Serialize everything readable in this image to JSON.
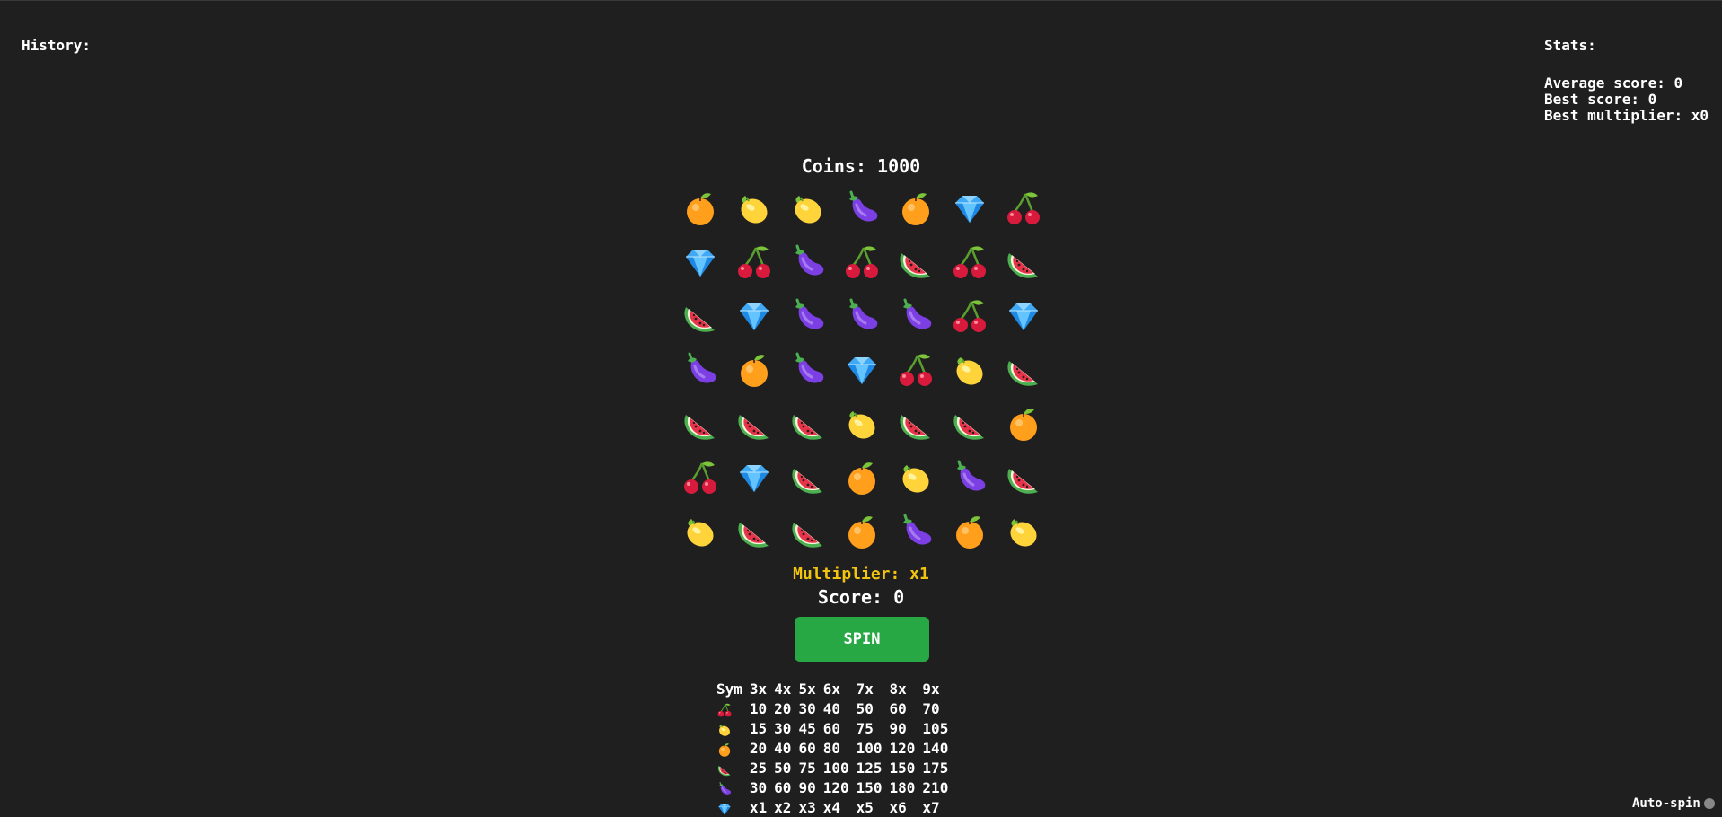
{
  "history": {
    "label": "History:"
  },
  "stats": {
    "title": "Stats:",
    "average_score": "Average score: 0",
    "best_score": "Best score: 0",
    "best_multiplier": "Best multiplier: x0"
  },
  "coins": "Coins: 1000",
  "grid": [
    [
      "orange",
      "lemon",
      "lemon",
      "eggplant",
      "orange",
      "diamond",
      "cherry"
    ],
    [
      "diamond",
      "cherry",
      "eggplant",
      "cherry",
      "watermelon",
      "cherry",
      "watermelon"
    ],
    [
      "watermelon",
      "diamond",
      "eggplant",
      "eggplant",
      "eggplant",
      "cherry",
      "diamond"
    ],
    [
      "eggplant",
      "orange",
      "eggplant",
      "diamond",
      "cherry",
      "lemon",
      "watermelon"
    ],
    [
      "watermelon",
      "watermelon",
      "watermelon",
      "lemon",
      "watermelon",
      "watermelon",
      "orange"
    ],
    [
      "cherry",
      "diamond",
      "watermelon",
      "orange",
      "lemon",
      "eggplant",
      "watermelon"
    ],
    [
      "lemon",
      "watermelon",
      "watermelon",
      "orange",
      "eggplant",
      "orange",
      "lemon"
    ]
  ],
  "multiplier": "Multiplier: x1",
  "score": "Score: 0",
  "spin_label": "SPIN",
  "paytable": {
    "headers": [
      "Sym",
      "3x",
      "4x",
      "5x",
      "6x",
      "7x",
      "8x",
      "9x"
    ],
    "rows": [
      {
        "symbol": "cherry",
        "values": [
          "10",
          "20",
          "30",
          "40",
          "50",
          "60",
          "70"
        ]
      },
      {
        "symbol": "lemon",
        "values": [
          "15",
          "30",
          "45",
          "60",
          "75",
          "90",
          "105"
        ]
      },
      {
        "symbol": "orange",
        "values": [
          "20",
          "40",
          "60",
          "80",
          "100",
          "120",
          "140"
        ]
      },
      {
        "symbol": "watermelon",
        "values": [
          "25",
          "50",
          "75",
          "100",
          "125",
          "150",
          "175"
        ]
      },
      {
        "symbol": "eggplant",
        "values": [
          "30",
          "60",
          "90",
          "120",
          "150",
          "180",
          "210"
        ]
      },
      {
        "symbol": "diamond",
        "values": [
          "x1",
          "x2",
          "x3",
          "x4",
          "x5",
          "x6",
          "x7"
        ]
      }
    ]
  },
  "autospin_label": "Auto-spin",
  "colors": {
    "background": "#1f1f1f",
    "spin_button": "#28a745",
    "multiplier_text": "#f1c40f",
    "autospin_dot": "#888888"
  }
}
